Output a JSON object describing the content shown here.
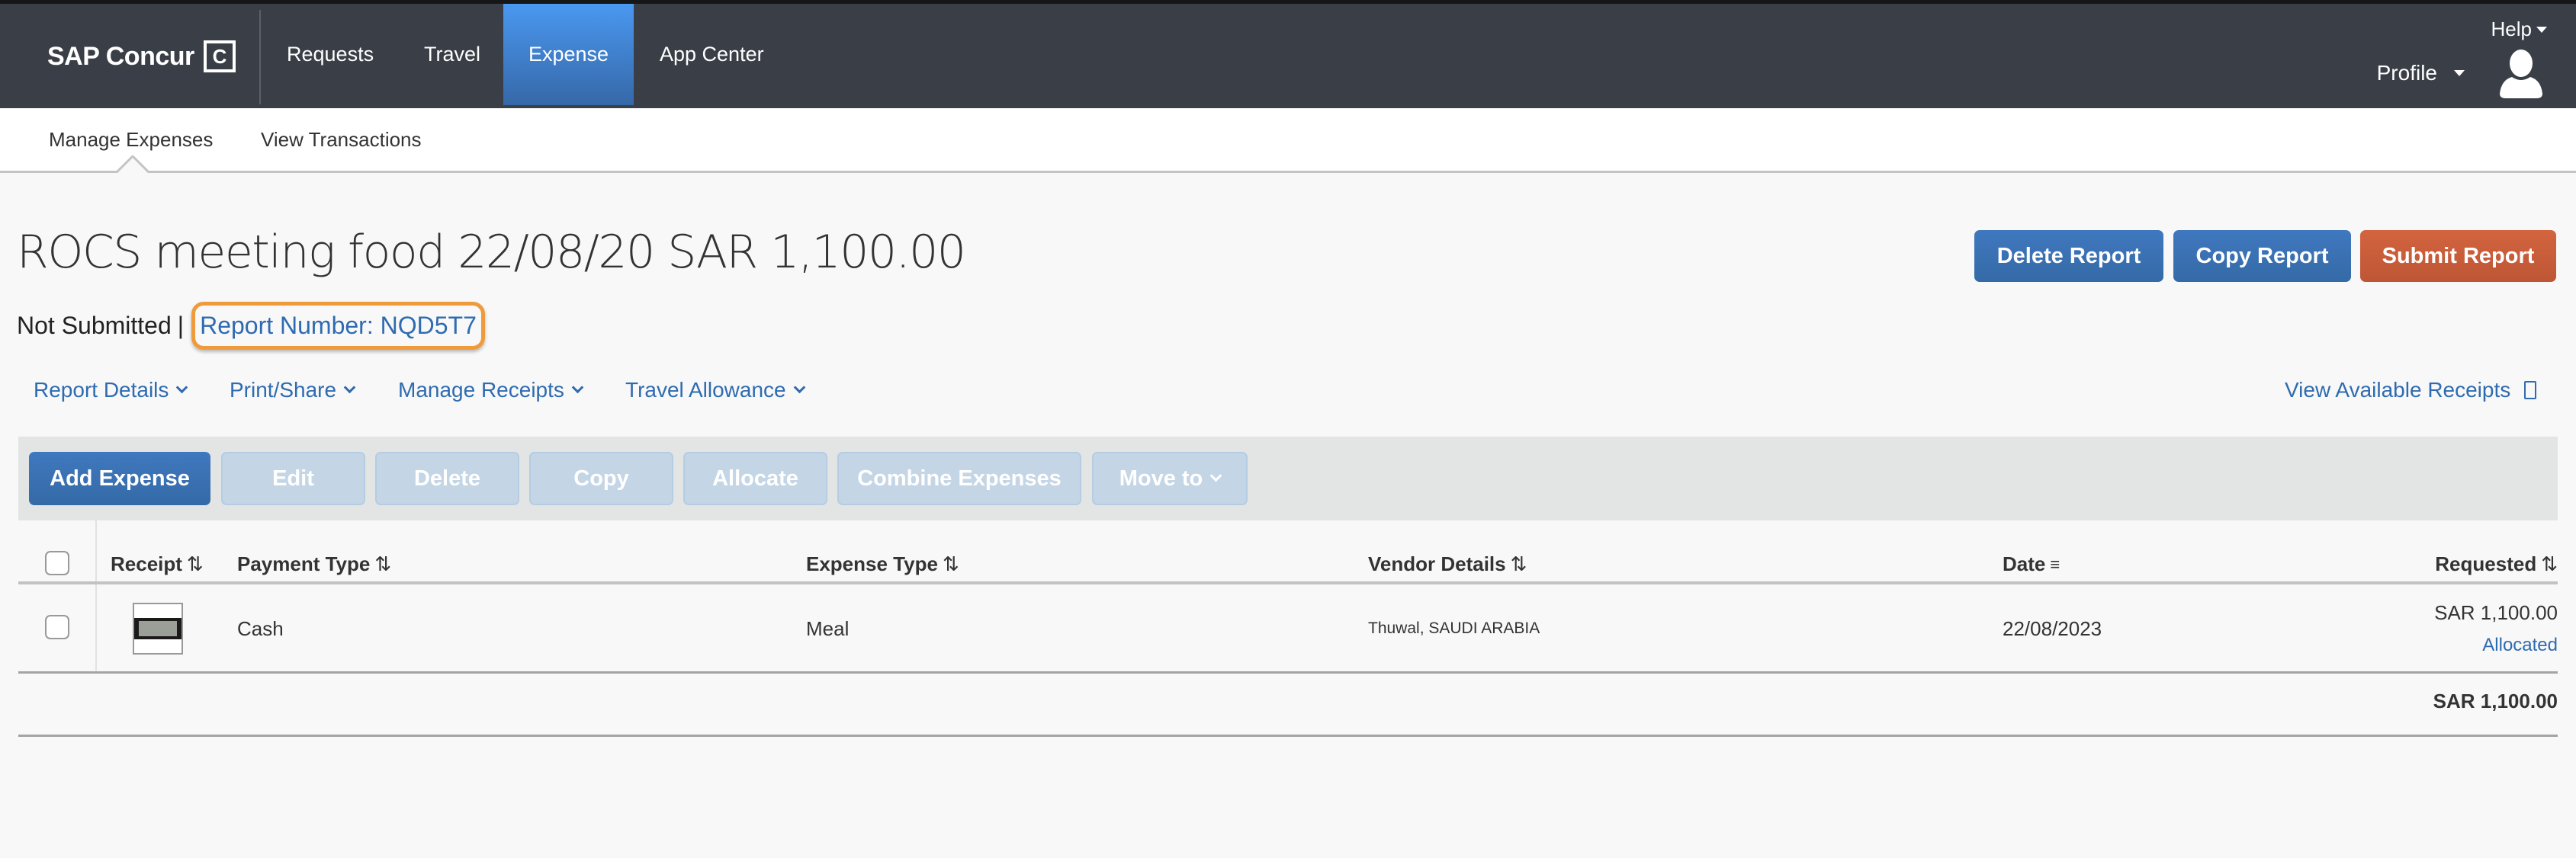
{
  "nav": {
    "brand": "SAP Concur",
    "brand_mark": "C",
    "items": [
      {
        "label": "Requests",
        "active": false
      },
      {
        "label": "Travel",
        "active": false
      },
      {
        "label": "Expense",
        "active": true
      },
      {
        "label": "App Center",
        "active": false
      }
    ],
    "help_label": "Help",
    "profile_label": "Profile",
    "active_color": "#4a98f0",
    "bar_color": "#3a3f47"
  },
  "subnav": {
    "items": [
      {
        "label": "Manage Expenses",
        "active": true
      },
      {
        "label": "View Transactions",
        "active": false
      }
    ]
  },
  "report": {
    "title": "ROCS meeting food 22/08/20 SAR 1,100.00",
    "status": "Not Submitted",
    "separator": "|",
    "report_number": "Report Number: NQD5T7",
    "highlight_color": "#ef9b3c"
  },
  "header_buttons": {
    "delete": "Delete Report",
    "copy": "Copy Report",
    "submit": "Submit Report",
    "submit_color": "#c95b38",
    "primary_color": "#3a71b3"
  },
  "action_links": {
    "items": [
      "Report Details",
      "Print/Share",
      "Manage Receipts",
      "Travel Allowance"
    ],
    "view_receipts": "View Available Receipts",
    "link_color": "#2e6bb0"
  },
  "toolbar": {
    "add_expense": "Add Expense",
    "edit": "Edit",
    "delete": "Delete",
    "copy": "Copy",
    "allocate": "Allocate",
    "combine": "Combine Expenses",
    "move_to": "Move to"
  },
  "table": {
    "columns": {
      "receipt": "Receipt",
      "payment_type": "Payment Type",
      "expense_type": "Expense Type",
      "vendor_details": "Vendor Details",
      "date": "Date",
      "requested": "Requested"
    },
    "sort_icon": "⇅",
    "filter_icon": "≡",
    "rows": [
      {
        "checked": false,
        "payment_type": "Cash",
        "expense_type": "Meal",
        "vendor_details": "Thuwal, SAUDI ARABIA",
        "date": "22/08/2023",
        "requested": "SAR 1,100.00",
        "allocation_status": "Allocated"
      }
    ],
    "total": "SAR 1,100.00"
  }
}
